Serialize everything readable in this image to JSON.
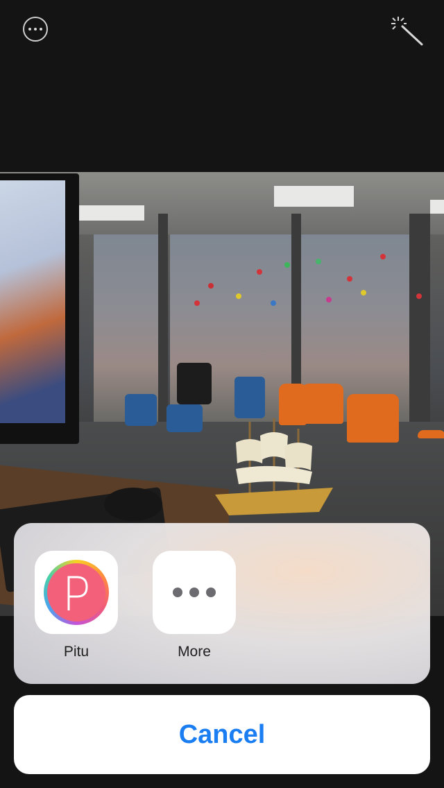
{
  "toolbar": {
    "more_icon": "ellipsis-circle-icon",
    "enhance_icon": "magic-wand-icon"
  },
  "photo": {
    "description_icon": "photo"
  },
  "share_sheet": {
    "apps": [
      {
        "label": "Pitu",
        "icon": "pitu-app-icon"
      },
      {
        "label": "More",
        "icon": "ellipsis-icon"
      }
    ]
  },
  "cancel_label": "Cancel",
  "colors": {
    "accent": "#1a7df2",
    "background": "#141414",
    "pitu_pink": "#f2607a"
  }
}
